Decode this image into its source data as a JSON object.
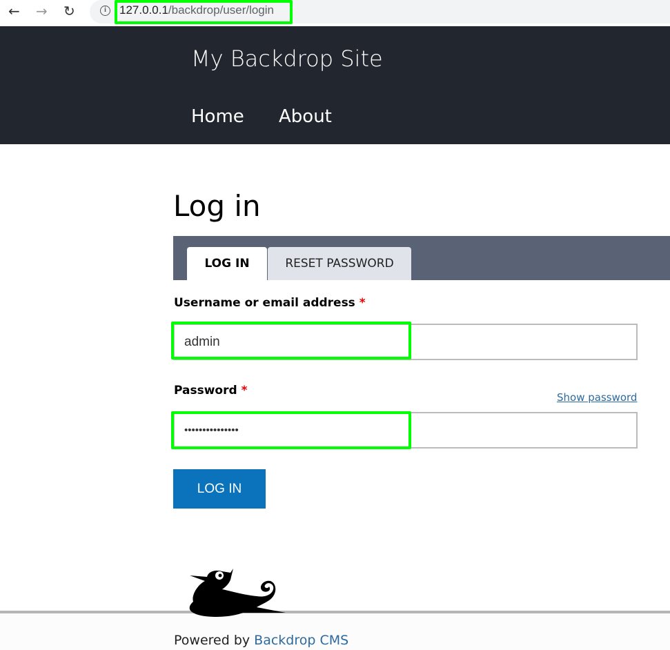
{
  "browser": {
    "url_host": "127.0.0.1",
    "url_path": "/backdrop/user/login",
    "back_icon": "arrow-left-icon",
    "forward_icon": "arrow-right-icon",
    "reload_icon": "reload-icon",
    "info_icon": "info-icon"
  },
  "header": {
    "site_name": "My Backdrop Site",
    "menu": [
      {
        "label": "Home"
      },
      {
        "label": "About"
      }
    ],
    "background": "#22262e"
  },
  "page": {
    "title": "Log in",
    "tabs": [
      {
        "label": "LOG IN",
        "active": true
      },
      {
        "label": "RESET PASSWORD",
        "active": false
      }
    ],
    "username": {
      "label": "Username or email address",
      "required_mark": "*",
      "value": "admin"
    },
    "password": {
      "label": "Password",
      "required_mark": "*",
      "value": "•••••••••••••••",
      "show_label": "Show password"
    },
    "submit_label": "LOG IN",
    "accent": "#0b72bc"
  },
  "footer": {
    "powered_prefix": "Powered by ",
    "powered_link": "Backdrop CMS",
    "logo": "backdrop-mascot-logo"
  }
}
